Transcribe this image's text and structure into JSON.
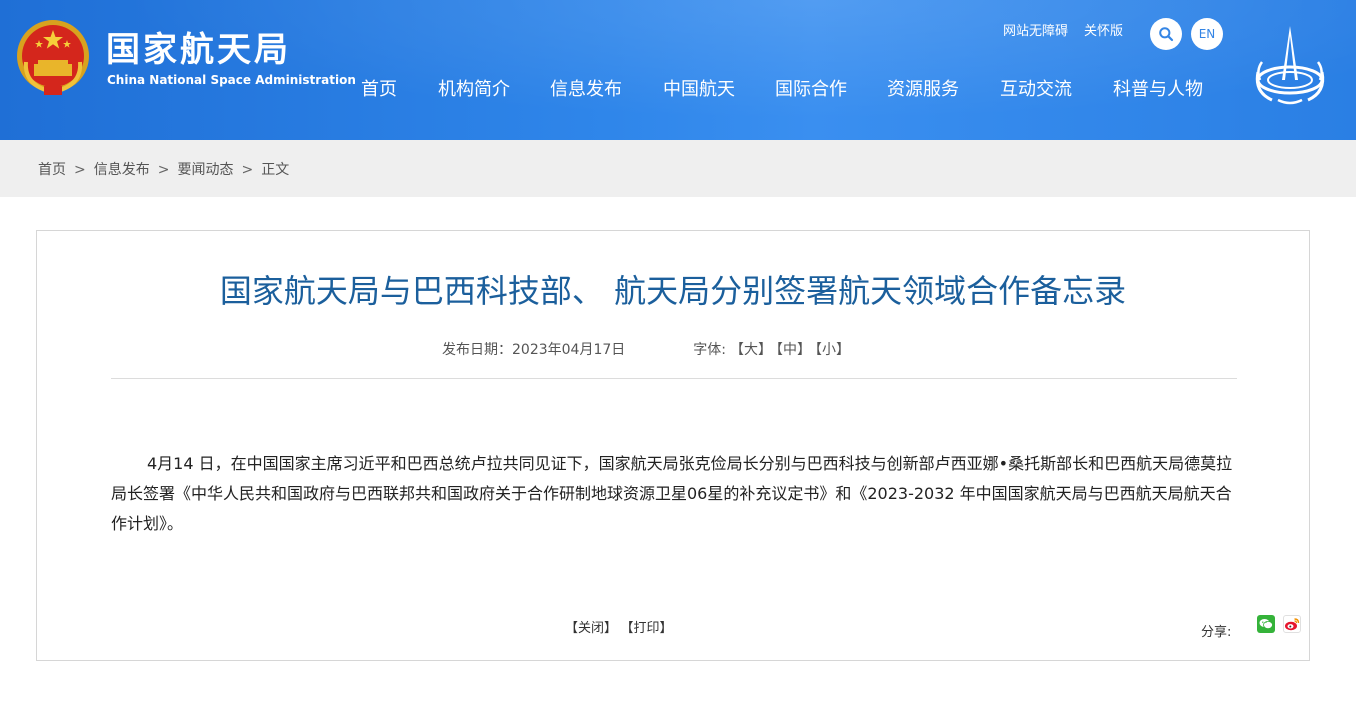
{
  "header": {
    "site_name": "国家航天局",
    "site_name_en": "China National Space Administration",
    "top_links": [
      "网站无障碍",
      "关怀版"
    ],
    "lang_button": "EN",
    "nav": [
      "首页",
      "机构简介",
      "信息发布",
      "中国航天",
      "国际合作",
      "资源服务",
      "互动交流",
      "科普与人物"
    ]
  },
  "breadcrumb": {
    "items": [
      "首页",
      "信息发布",
      "要闻动态",
      "正文"
    ],
    "separator": ">"
  },
  "article": {
    "title": "国家航天局与巴西科技部、 航天局分别签署航天领域合作备忘录",
    "date_label": "发布日期：2023年04月17日",
    "font_label": "字体:",
    "font_sizes": [
      "【大】",
      "【中】",
      "【小】"
    ],
    "body": "4月14 日，在中国国家主席习近平和巴西总统卢拉共同见证下，国家航天局张克俭局长分别与巴西科技与创新部卢西亚娜•桑托斯部长和巴西航天局德莫拉局长签署《中华人民共和国政府与巴西联邦共和国政府关于合作研制地球资源卫星06星的补充议定书》和《2023-2032 年中国国家航天局与巴西航天局航天合作计划》。",
    "close_label": "【关闭】",
    "print_label": "【打印】",
    "share_label": "分享:"
  },
  "colors": {
    "header_blue": "#2a7fe4",
    "title_blue": "#1b5f9c",
    "breadcrumb_bg": "#efefef"
  }
}
